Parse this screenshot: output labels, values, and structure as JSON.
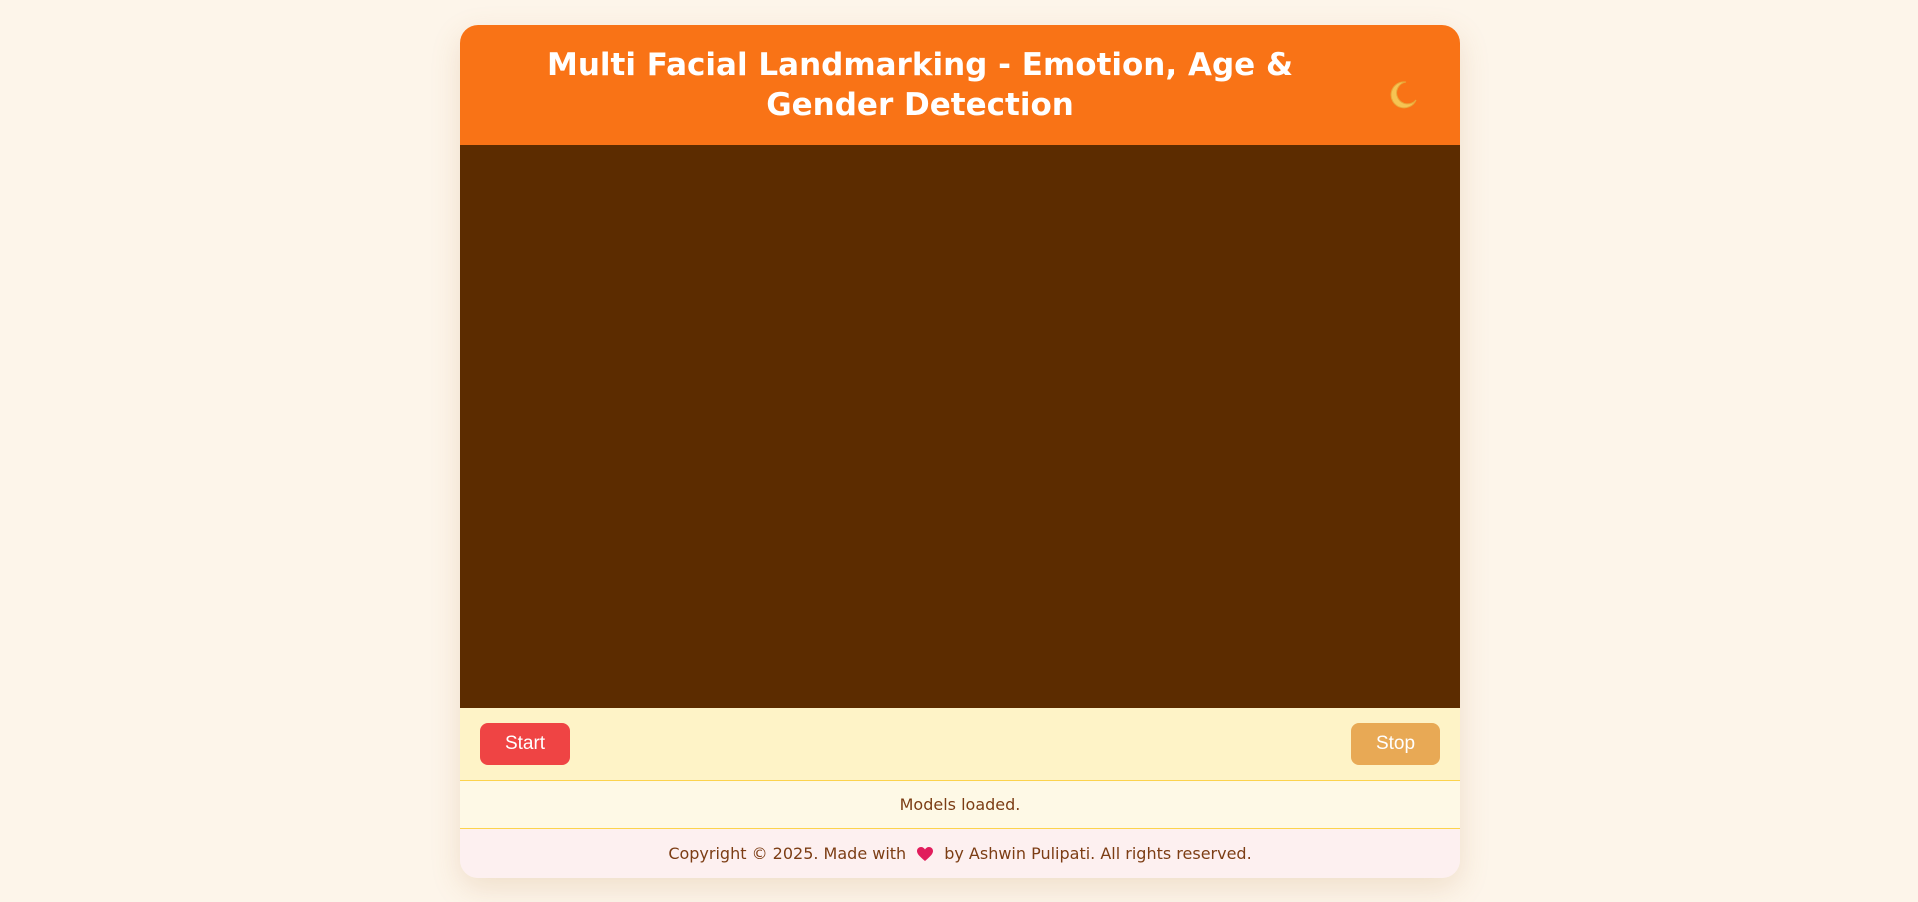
{
  "header": {
    "title": "Multi Facial Landmarking - Emotion, Age & Gender Detection",
    "theme_toggle_icon": "moon-icon"
  },
  "video": {
    "background_color": "#5c2c00"
  },
  "controls": {
    "start_label": "Start",
    "stop_label": "Stop"
  },
  "status": {
    "text": "Models loaded."
  },
  "footer": {
    "prefix": "Copyright © 2025. Made with",
    "heart_icon": "heart-icon",
    "suffix": "by Ashwin Pulipati. All rights reserved."
  },
  "colors": {
    "page_background": "#fdf5ea",
    "header": "#f97316",
    "start_button": "#ef4444",
    "stop_button": "#e8a955",
    "controls_background": "#fef3c7",
    "text_brown": "#7c3d14"
  }
}
